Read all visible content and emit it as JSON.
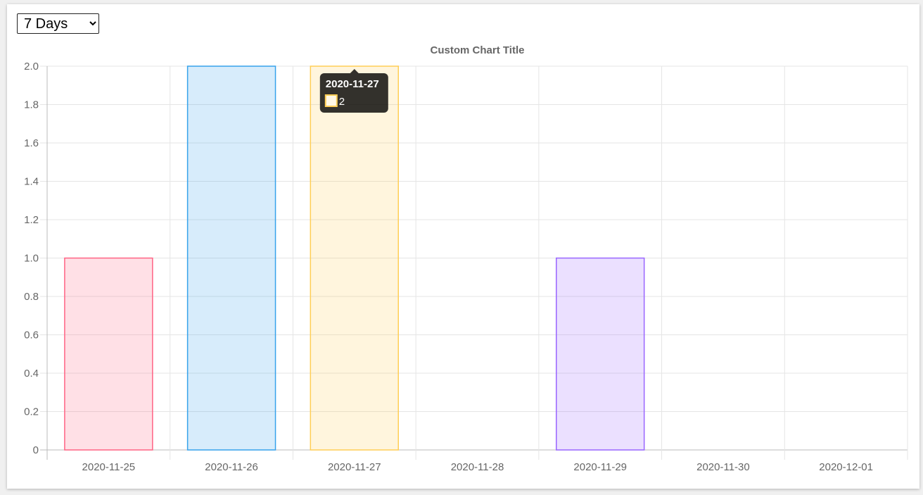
{
  "controls": {
    "range_select": {
      "selected": "7 Days",
      "options": [
        "7 Days"
      ]
    }
  },
  "chart_data": {
    "type": "bar",
    "title": "Custom Chart Title",
    "xlabel": "",
    "ylabel": "",
    "categories": [
      "2020-11-25",
      "2020-11-26",
      "2020-11-27",
      "2020-11-28",
      "2020-11-29",
      "2020-11-30",
      "2020-12-01"
    ],
    "values": [
      1,
      2,
      2,
      0,
      1,
      0,
      0
    ],
    "ylim": [
      0,
      2
    ],
    "yticks": [
      0,
      0.2,
      0.4,
      0.6,
      0.8,
      1.0,
      1.2,
      1.4,
      1.6,
      1.8,
      2.0
    ],
    "ytick_labels": [
      "0",
      "0.2",
      "0.4",
      "0.6",
      "0.8",
      "1.0",
      "1.2",
      "1.4",
      "1.6",
      "1.8",
      "2.0"
    ],
    "grid": true,
    "bar_colors": [
      {
        "fill": "rgba(255,99,132,0.2)",
        "stroke": "#ff6384"
      },
      {
        "fill": "rgba(54,162,235,0.2)",
        "stroke": "#36a2eb"
      },
      {
        "fill": "rgba(255,206,86,0.2)",
        "stroke": "#ffce56"
      },
      {
        "fill": "rgba(75,192,192,0.2)",
        "stroke": "#4bc0c0"
      },
      {
        "fill": "rgba(153,102,255,0.2)",
        "stroke": "#9966ff"
      },
      {
        "fill": "rgba(255,159,64,0.2)",
        "stroke": "#ff9f40"
      },
      {
        "fill": "rgba(201,203,207,0.2)",
        "stroke": "#c9cbcf"
      }
    ],
    "tooltip": {
      "category_index": 2,
      "title": "2020-11-27",
      "value_label": "2"
    }
  }
}
